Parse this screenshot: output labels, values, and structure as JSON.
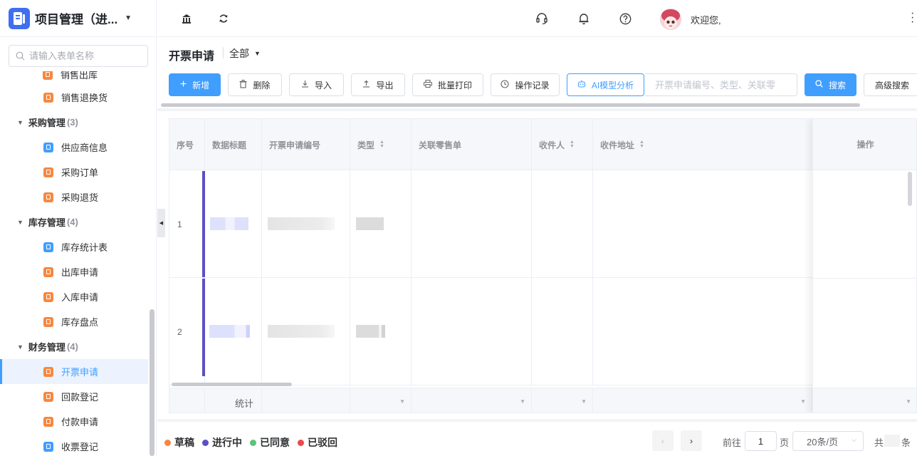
{
  "app": {
    "title": "项目管理（进..."
  },
  "sidebar": {
    "search_placeholder": "请输入表单名称",
    "clipped_item": "销售出库",
    "entries": [
      {
        "kind": "item",
        "label": "销售退换货",
        "icon": "form-icon",
        "color": "orange",
        "active": false
      },
      {
        "kind": "group",
        "label": "采购管理",
        "count": "(3)"
      },
      {
        "kind": "item",
        "label": "供应商信息",
        "icon": "form-icon",
        "color": "blue",
        "active": false
      },
      {
        "kind": "item",
        "label": "采购订单",
        "icon": "form-icon",
        "color": "orange",
        "active": false
      },
      {
        "kind": "item",
        "label": "采购退货",
        "icon": "form-icon",
        "color": "orange",
        "active": false
      },
      {
        "kind": "group",
        "label": "库存管理",
        "count": "(4)"
      },
      {
        "kind": "item",
        "label": "库存统计表",
        "icon": "form-icon",
        "color": "blue",
        "active": false
      },
      {
        "kind": "item",
        "label": "出库申请",
        "icon": "form-icon",
        "color": "orange",
        "active": false
      },
      {
        "kind": "item",
        "label": "入库申请",
        "icon": "form-icon",
        "color": "orange",
        "active": false
      },
      {
        "kind": "item",
        "label": "库存盘点",
        "icon": "form-icon",
        "color": "orange",
        "active": false
      },
      {
        "kind": "group",
        "label": "财务管理",
        "count": "(4)"
      },
      {
        "kind": "item",
        "label": "开票申请",
        "icon": "form-icon",
        "color": "orange",
        "active": true
      },
      {
        "kind": "item",
        "label": "回款登记",
        "icon": "form-icon",
        "color": "orange",
        "active": false
      },
      {
        "kind": "item",
        "label": "付款申请",
        "icon": "form-icon",
        "color": "orange",
        "active": false
      },
      {
        "kind": "item",
        "label": "收票登记",
        "icon": "form-icon",
        "color": "blue",
        "active": false
      }
    ]
  },
  "topbar": {
    "icons": [
      "bank-icon",
      "refresh-icon",
      "headset-icon",
      "bell-icon",
      "help-icon"
    ],
    "welcome": "欢迎您,"
  },
  "page": {
    "title": "开票申请",
    "filter": "全部"
  },
  "toolbar": {
    "add": "新增",
    "delete": "删除",
    "import": "导入",
    "export": "导出",
    "batch_print": "批量打印",
    "op_log": "操作记录",
    "ai": "AI模型分析",
    "search_placeholder": "开票申请编号、类型、关联零",
    "search": "搜索",
    "advanced": "高级搜索"
  },
  "table": {
    "columns": [
      "序号",
      "数据标题",
      "开票申请编号",
      "类型",
      "关联零售单",
      "收件人",
      "收件地址"
    ],
    "op_column": "操作",
    "rows": [
      {
        "index": "1"
      },
      {
        "index": "2"
      }
    ],
    "summary_label": "统计"
  },
  "legend": [
    {
      "label": "草稿",
      "color": "#f7873f"
    },
    {
      "label": "进行中",
      "color": "#5b4fc4"
    },
    {
      "label": "已同意",
      "color": "#5cc47a"
    },
    {
      "label": "已驳回",
      "color": "#f04747"
    }
  ],
  "pagination": {
    "goto_prefix": "前往",
    "page": "1",
    "goto_suffix": "页",
    "page_size": "20条/页",
    "total_prefix": "共",
    "total_suffix": "条"
  },
  "colors": {
    "primary": "#409eff",
    "status_in_progress": "#5b4fc4"
  }
}
